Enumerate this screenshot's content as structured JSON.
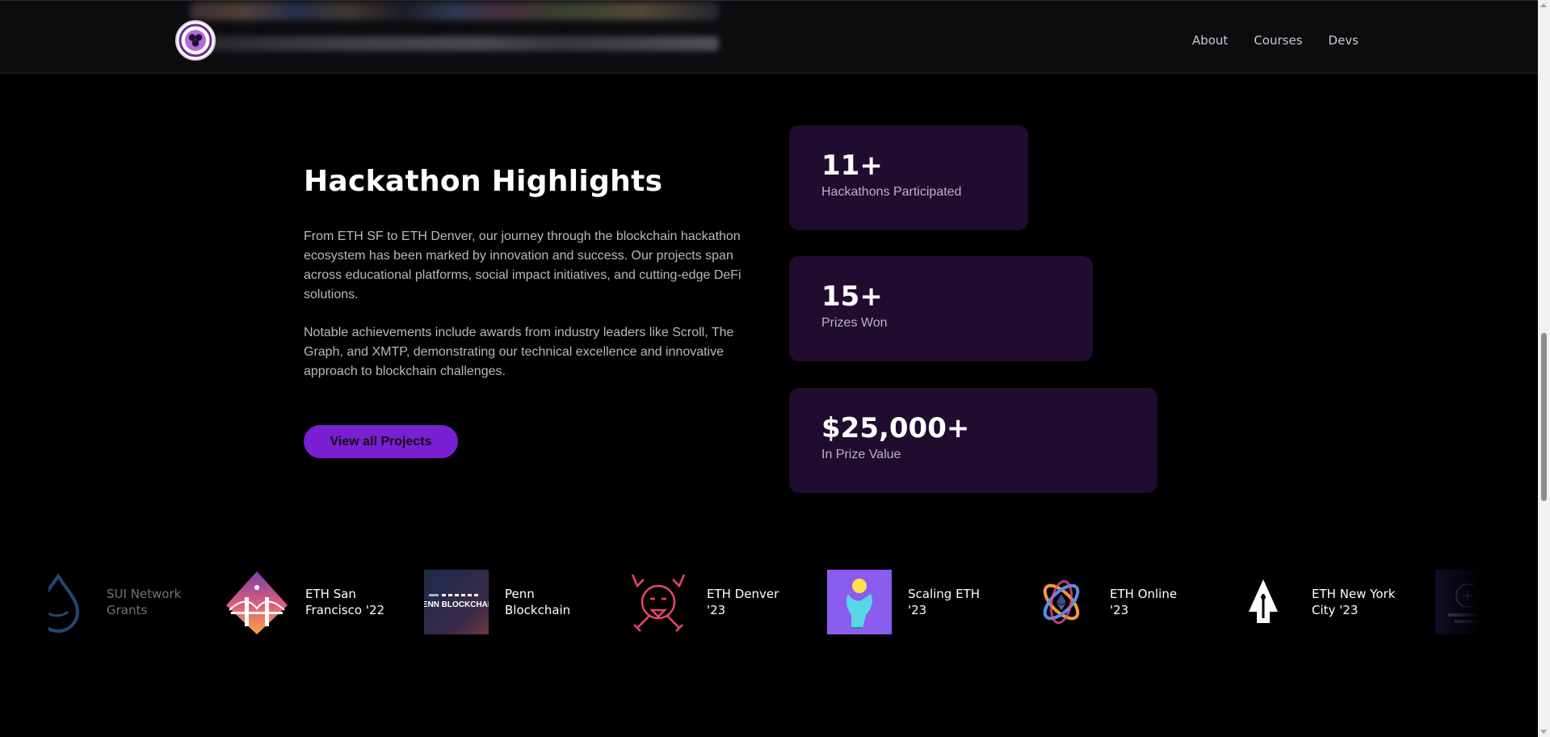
{
  "header": {
    "logo_icon": "penn-blockchain-logo",
    "nav": [
      {
        "label": "About"
      },
      {
        "label": "Courses"
      },
      {
        "label": "Devs"
      }
    ]
  },
  "intro": {
    "title": "Hackathon Highlights",
    "paragraph_1": "From ETH SF to ETH Denver, our journey through the blockchain hackathon ecosystem has been marked by innovation and success. Our projects span across educational platforms, social impact initiatives, and cutting-edge DeFi solutions.",
    "paragraph_2": "Notable achievements include awards from industry leaders like Scroll, The Graph, and XMTP, demonstrating our technical excellence and innovative approach to blockchain challenges.",
    "cta_label": "View all Projects"
  },
  "stats": [
    {
      "value": "11+",
      "label": "Hackathons Participated"
    },
    {
      "value": "15+",
      "label": "Prizes Won"
    },
    {
      "value": "$25,000+",
      "label": "In Prize Value"
    }
  ],
  "carousel": {
    "items": [
      {
        "label": "SUI Network Grants",
        "icon": "sui-droplet-icon"
      },
      {
        "label": "ETH San Francisco '22",
        "icon": "golden-gate-bridge-icon"
      },
      {
        "label": "Penn Blockchain",
        "icon": "penn-blockchain-banner-icon",
        "icon_text": "PENN BLOCKCHAIN"
      },
      {
        "label": "ETH Denver '23",
        "icon": "buffalo-skull-icon"
      },
      {
        "label": "Scaling ETH '23",
        "icon": "hand-holding-ball-icon"
      },
      {
        "label": "ETH Online '23",
        "icon": "ethereum-atom-icon"
      },
      {
        "label": "ETH New York City '23",
        "icon": "pen-nib-icon"
      },
      {
        "label": "",
        "icon": "ethdenver-2024-icon"
      }
    ]
  },
  "colors": {
    "accent": "#7a1fd1",
    "card_bg": "#1f0c2f",
    "background": "#000000"
  }
}
